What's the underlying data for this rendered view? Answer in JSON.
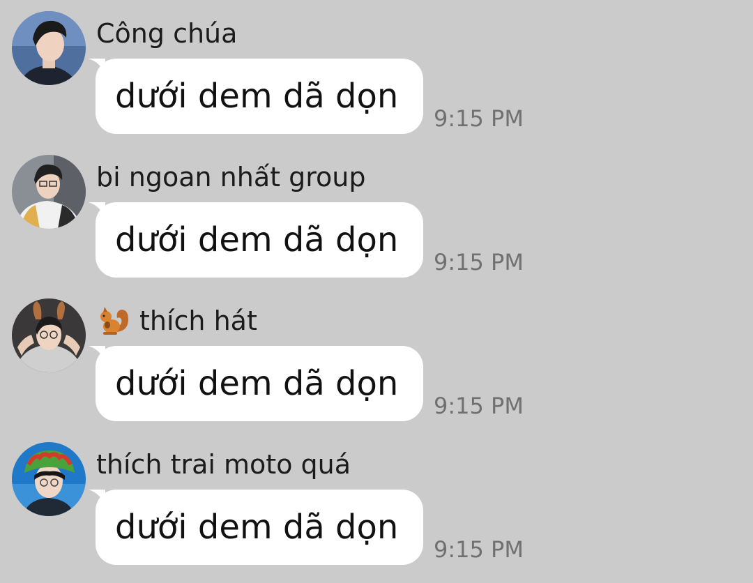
{
  "messages": [
    {
      "sender": "Công chúa",
      "text": "dưới dem dã dọn",
      "time": "9:15 PM",
      "avatar": "avatar-photo-1"
    },
    {
      "sender": "bi ngoan nhất group",
      "text": "dưới dem dã dọn",
      "time": "9:15 PM",
      "avatar": "avatar-photo-2"
    },
    {
      "sender": "thích hát",
      "sender_icon": "squirrel-emoji-icon",
      "text": "dưới dem dã dọn",
      "time": "9:15 PM",
      "avatar": "avatar-photo-3"
    },
    {
      "sender": "thích trai moto quá",
      "text": "dưới dem dã dọn",
      "time": "9:15 PM",
      "avatar": "avatar-photo-4"
    }
  ],
  "colors": {
    "background": "#cbcbcb",
    "bubble": "#ffffff",
    "timestamp": "#707070"
  }
}
